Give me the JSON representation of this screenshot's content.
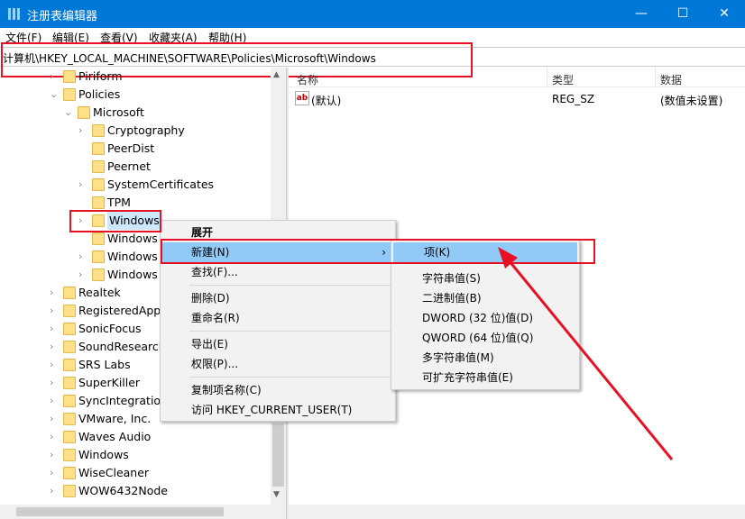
{
  "window": {
    "title": "注册表编辑器",
    "minimize": "—",
    "maximize": "☐",
    "close": "✕"
  },
  "menu": [
    "文件(F)",
    "编辑(E)",
    "查看(V)",
    "收藏夹(A)",
    "帮助(H)"
  ],
  "address": "计算机\\HKEY_LOCAL_MACHINE\\SOFTWARE\\Policies\\Microsoft\\Windows",
  "tree": [
    {
      "label": "Piriform",
      "level": 1,
      "chev": ">"
    },
    {
      "label": "Policies",
      "level": 1,
      "chev": "v"
    },
    {
      "label": "Microsoft",
      "level": 2,
      "chev": "v"
    },
    {
      "label": "Cryptography",
      "level": 3,
      "chev": ">"
    },
    {
      "label": "PeerDist",
      "level": 3,
      "chev": ""
    },
    {
      "label": "Peernet",
      "level": 3,
      "chev": ""
    },
    {
      "label": "SystemCertificates",
      "level": 3,
      "chev": ">"
    },
    {
      "label": "TPM",
      "level": 3,
      "chev": ""
    },
    {
      "label": "Windows",
      "level": 3,
      "chev": ">"
    },
    {
      "label": "Windows",
      "level": 3,
      "chev": ""
    },
    {
      "label": "Windows",
      "level": 3,
      "chev": ">"
    },
    {
      "label": "Windows",
      "level": 3,
      "chev": ">"
    },
    {
      "label": "Realtek",
      "level": 1,
      "chev": ">"
    },
    {
      "label": "RegisteredApp",
      "level": 1,
      "chev": ">"
    },
    {
      "label": "SonicFocus",
      "level": 1,
      "chev": ">"
    },
    {
      "label": "SoundResearch",
      "level": 1,
      "chev": ">"
    },
    {
      "label": "SRS Labs",
      "level": 1,
      "chev": ">"
    },
    {
      "label": "SuperKiller",
      "level": 1,
      "chev": ">"
    },
    {
      "label": "SyncIntegration",
      "level": 1,
      "chev": ">"
    },
    {
      "label": "VMware, Inc.",
      "level": 1,
      "chev": ">"
    },
    {
      "label": "Waves Audio",
      "level": 1,
      "chev": ">"
    },
    {
      "label": "Windows",
      "level": 1,
      "chev": ">"
    },
    {
      "label": "WiseCleaner",
      "level": 1,
      "chev": ">"
    },
    {
      "label": "WOW6432Node",
      "level": 1,
      "chev": ">"
    }
  ],
  "list": {
    "headers": [
      "名称",
      "类型",
      "数据"
    ],
    "rows": [
      {
        "name": "(默认)",
        "type": "REG_SZ",
        "data": "(数值未设置)"
      }
    ]
  },
  "context_menu": {
    "items": [
      "展开",
      "新建(N)",
      "查找(F)...",
      "删除(D)",
      "重命名(R)",
      "导出(E)",
      "权限(P)...",
      "复制项名称(C)",
      "访问 HKEY_CURRENT_USER(T)"
    ]
  },
  "submenu": {
    "items": [
      "项(K)",
      "字符串值(S)",
      "二进制值(B)",
      "DWORD (32 位)值(D)",
      "QWORD (64 位)值(Q)",
      "多字符串值(M)",
      "可扩充字符串值(E)"
    ]
  },
  "colors": {
    "titlebar": "#0078d7",
    "highlight": "#91c9f7",
    "annotation": "#e81123"
  }
}
